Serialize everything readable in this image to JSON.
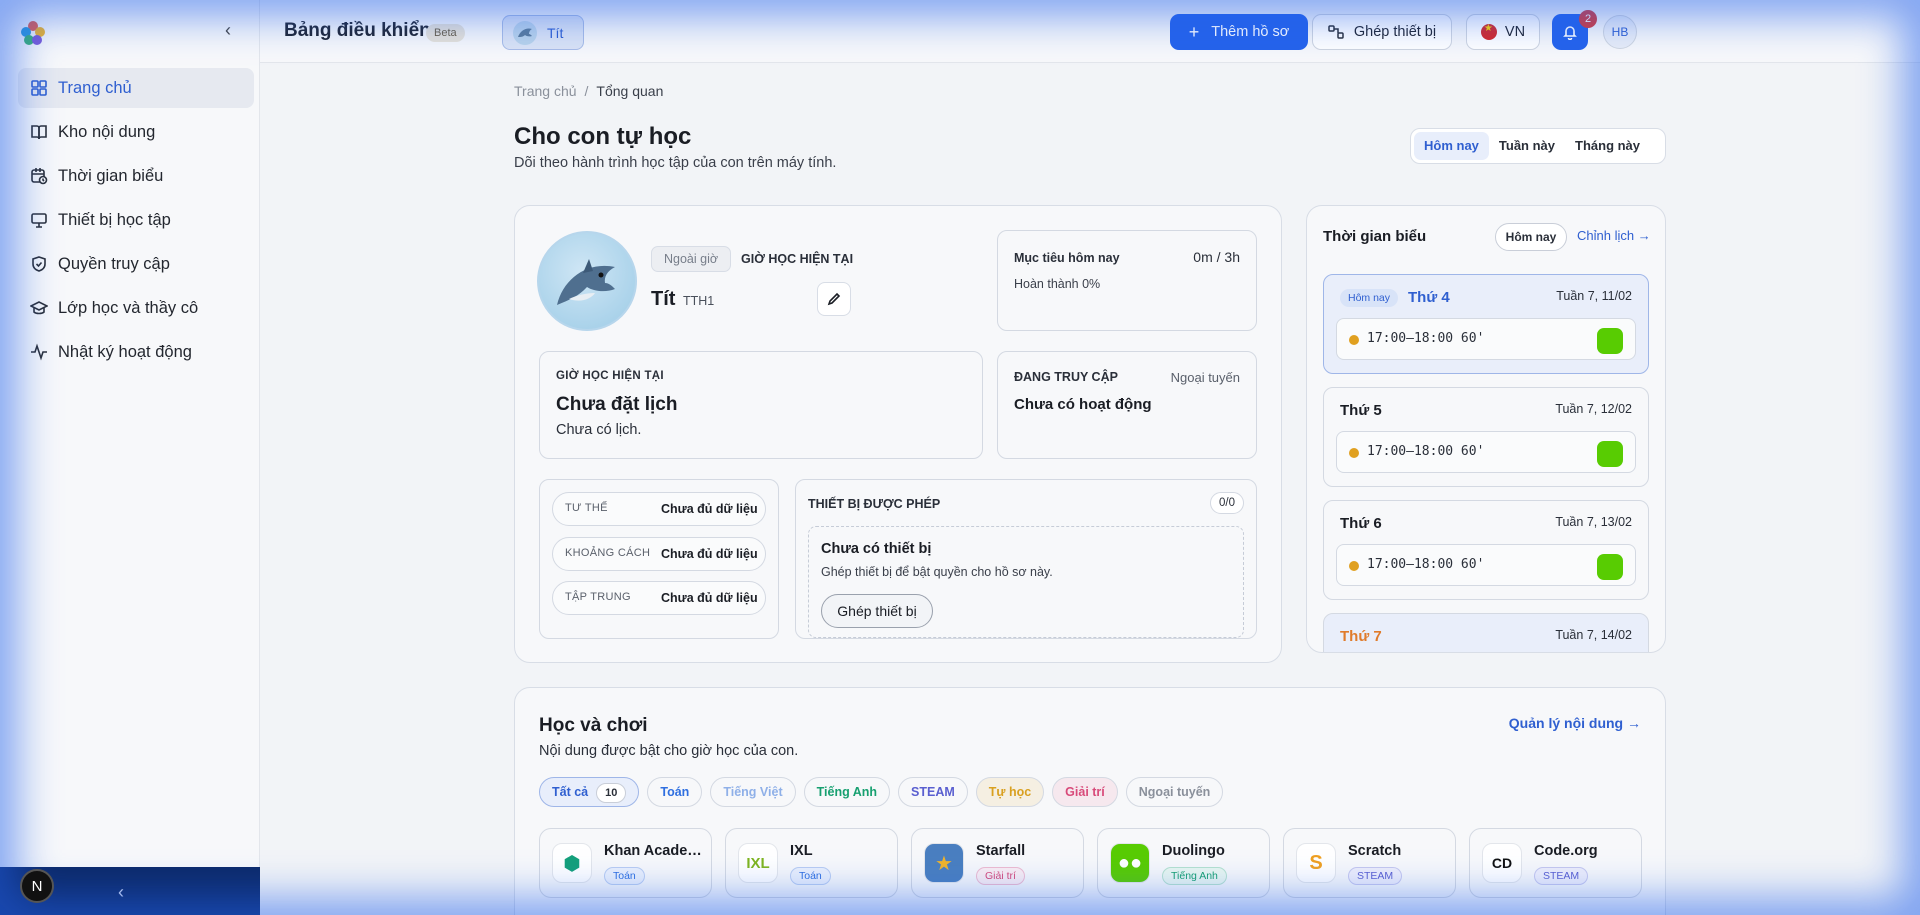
{
  "app": {
    "title": "Bảng điều khiển",
    "beta": "Beta",
    "profile_chip": "Tít"
  },
  "topbar": {
    "add_profile": "Thêm hồ sơ",
    "pair_device": "Ghép thiết bị",
    "lang": "VN",
    "notifications": "2",
    "user_initials": "HB"
  },
  "sidebar": {
    "items": [
      {
        "label": "Trang chủ",
        "icon": "dashboard-icon",
        "active": true
      },
      {
        "label": "Kho nội dung",
        "icon": "book-icon"
      },
      {
        "label": "Thời gian biểu",
        "icon": "calendar-clock-icon"
      },
      {
        "label": "Thiết bị học tập",
        "icon": "monitor-icon"
      },
      {
        "label": "Quyền truy cập",
        "icon": "shield-icon"
      },
      {
        "label": "Lớp học và thầy cô",
        "icon": "graduation-cap-icon"
      },
      {
        "label": "Nhật ký hoạt động",
        "icon": "activity-icon"
      }
    ],
    "footer_avatar": "N"
  },
  "breadcrumb": {
    "home": "Trang chủ",
    "sep": "/",
    "current": "Tổng quan"
  },
  "page": {
    "title": "Cho con tự học",
    "subtitle": "Dõi theo hành trình học tập của con trên máy tính.",
    "range_tabs": [
      "Hôm nay",
      "Tuần này",
      "Tháng này"
    ]
  },
  "profile": {
    "status_chip": "Ngoài giờ",
    "status_label": "GIỜ HỌC HIỆN TẠI",
    "name": "Tít",
    "code": "TTH1",
    "goal_title": "Mục tiêu hôm nay",
    "goal_value": "0m / 3h",
    "goal_done": "Hoàn thành 0%",
    "hour_title": "GIỜ HỌC HIỆN TẠI",
    "hour_main": "Chưa đặt lịch",
    "hour_sub": "Chưa có lịch.",
    "access_title": "ĐANG TRUY CẬP",
    "access_status": "Ngoại tuyến",
    "access_main": "Chưa có hoạt động",
    "metrics": [
      {
        "key": "TƯ THẾ",
        "value": "Chưa đủ dữ liệu"
      },
      {
        "key": "KHOẢNG CÁCH",
        "value": "Chưa đủ dữ liệu"
      },
      {
        "key": "TẬP TRUNG",
        "value": "Chưa đủ dữ liệu"
      }
    ],
    "devices_title": "THIẾT BỊ ĐƯỢC PHÉP",
    "devices_count": "0/0",
    "devices_empty_title": "Chưa có thiết bị",
    "devices_empty_sub": "Ghép thiết bị để bật quyền cho hồ sơ này.",
    "devices_button": "Ghép thiết bị"
  },
  "schedule": {
    "title": "Thời gian biểu",
    "today_button": "Hôm nay",
    "edit_link": "Chỉnh lịch →",
    "today_pill": "Hôm nay",
    "days": [
      {
        "name": "Thứ 4",
        "date": "Tuần 7, 11/02",
        "time": "17:00–18:00",
        "dur": "60'"
      },
      {
        "name": "Thứ 5",
        "date": "Tuần 7, 12/02",
        "time": "17:00–18:00",
        "dur": "60'"
      },
      {
        "name": "Thứ 6",
        "date": "Tuần 7, 13/02",
        "time": "17:00–18:00",
        "dur": "60'"
      },
      {
        "name": "Thứ 7",
        "date": "Tuần 7, 14/02"
      }
    ]
  },
  "learn": {
    "title": "Học và chơi",
    "subtitle": "Nội dung được bật cho giờ học của con.",
    "manage_link": "Quản lý nội dung →",
    "filters": [
      {
        "label": "Tất cả",
        "count": "10",
        "color": "#2f5fd0"
      },
      {
        "label": "Toán",
        "color": "#2f6fe0"
      },
      {
        "label": "Tiếng Việt",
        "color": "#8fb0e8"
      },
      {
        "label": "Tiếng Anh",
        "color": "#17a070"
      },
      {
        "label": "STEAM",
        "color": "#5a5fd0"
      },
      {
        "label": "Tự học",
        "color": "#d9a020"
      },
      {
        "label": "Giải trí",
        "color": "#d84a7a"
      },
      {
        "label": "Ngoại tuyến",
        "color": "#8a909b"
      }
    ],
    "apps": [
      {
        "name": "Khan Academy",
        "tag": "Toán",
        "tag_color": "#2f6fe0",
        "icon": "khan-academy-icon"
      },
      {
        "name": "IXL",
        "tag": "Toán",
        "tag_color": "#2f6fe0",
        "icon": "ixl-icon"
      },
      {
        "name": "Starfall",
        "tag": "Giải trí",
        "tag_color": "#d84a7a",
        "icon": "starfall-icon"
      },
      {
        "name": "Duolingo",
        "tag": "Tiếng Anh",
        "tag_color": "#17a070",
        "icon": "duolingo-icon"
      },
      {
        "name": "Scratch",
        "tag": "STEAM",
        "tag_color": "#5a5fd0",
        "icon": "scratch-icon"
      },
      {
        "name": "Code.org",
        "tag": "STEAM",
        "tag_color": "#5a5fd0",
        "icon": "code-org-icon"
      }
    ]
  }
}
